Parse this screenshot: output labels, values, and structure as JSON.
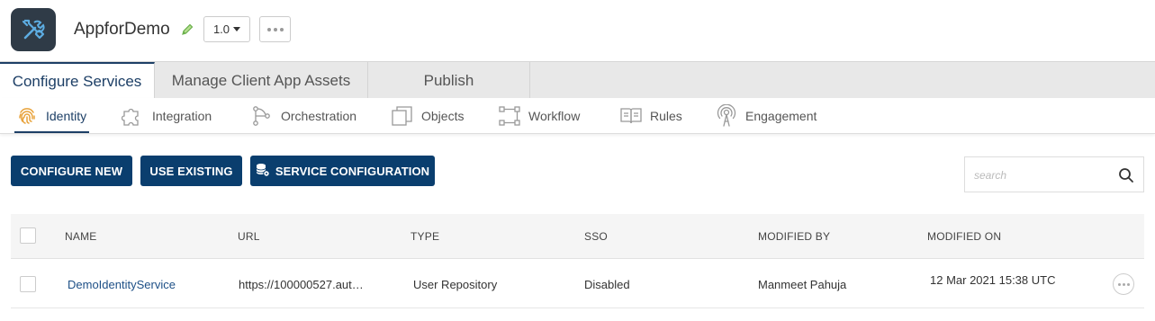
{
  "app": {
    "name": "AppforDemo",
    "version": "1.0",
    "icon": "tools-icon"
  },
  "main_tabs": [
    {
      "label": "Configure Services",
      "active": true
    },
    {
      "label": "Manage Client App Assets",
      "active": false
    },
    {
      "label": "Publish",
      "active": false
    }
  ],
  "sub_tabs": [
    {
      "label": "Identity",
      "icon": "fingerprint-icon",
      "active": true
    },
    {
      "label": "Integration",
      "icon": "puzzle-icon",
      "active": false
    },
    {
      "label": "Orchestration",
      "icon": "orchestration-icon",
      "active": false
    },
    {
      "label": "Objects",
      "icon": "objects-icon",
      "active": false
    },
    {
      "label": "Workflow",
      "icon": "workflow-icon",
      "active": false
    },
    {
      "label": "Rules",
      "icon": "rules-book-icon",
      "active": false
    },
    {
      "label": "Engagement",
      "icon": "engagement-icon",
      "active": false
    }
  ],
  "actions": {
    "configure_new": "CONFIGURE NEW",
    "use_existing": "USE EXISTING",
    "service_configuration": "SERVICE CONFIGURATION"
  },
  "search": {
    "placeholder": "search",
    "value": ""
  },
  "table": {
    "columns": [
      "NAME",
      "URL",
      "TYPE",
      "SSO",
      "MODIFIED BY",
      "MODIFIED ON"
    ],
    "rows": [
      {
        "name": "DemoIdentityService",
        "url": "https://100000527.aut…",
        "type": "User Repository",
        "sso": "Disabled",
        "modified_by": "Manmeet Pahuja",
        "modified_on": "12 Mar 2021 15:38 UTC"
      }
    ]
  },
  "colors": {
    "primary": "#0a3e6e",
    "accent_identity": "#e8a23a",
    "edit_icon": "#6ab04c"
  }
}
